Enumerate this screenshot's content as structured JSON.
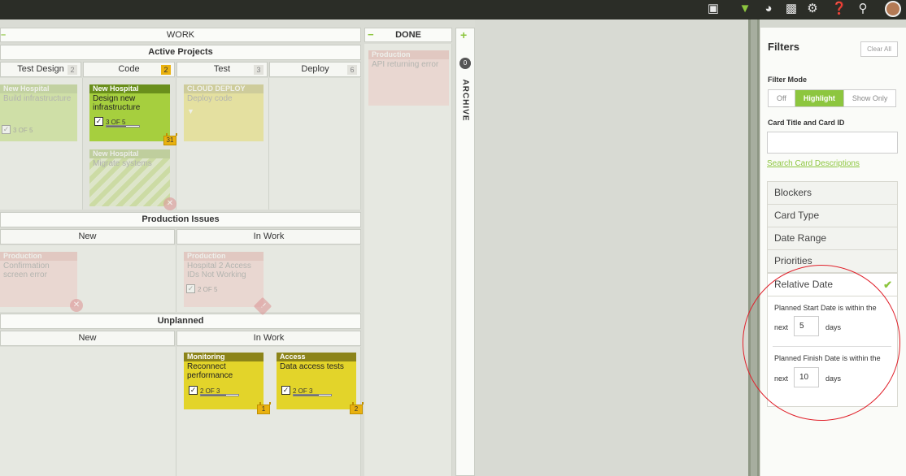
{
  "topbar": {
    "icons": [
      "new-card-icon",
      "filter-icon",
      "timer-icon",
      "analytics-icon",
      "gear-icon",
      "help-icon",
      "search-icon"
    ],
    "accent": "#8dc63f"
  },
  "board": {
    "work_header": "WORK",
    "done_header": "DONE",
    "archive_label": "ARCHIVE",
    "archive_count": "0",
    "lanes": {
      "active": {
        "title": "Active Projects",
        "columns": [
          {
            "label": "Test Design",
            "count": "2"
          },
          {
            "label": "Code",
            "count": "2"
          },
          {
            "label": "Test",
            "count": "3"
          },
          {
            "label": "Deploy",
            "count": "6"
          }
        ]
      },
      "production": {
        "title": "Production Issues",
        "columns": [
          {
            "label": "New"
          },
          {
            "label": "In Work"
          }
        ]
      },
      "unplanned": {
        "title": "Unplanned",
        "columns": [
          {
            "label": "New"
          },
          {
            "label": "In Work"
          }
        ]
      }
    },
    "cards": {
      "td1": {
        "title": "New Hospital",
        "body": "Build infrastructure",
        "progress": "3 OF 5"
      },
      "code1": {
        "title": "New Hospital",
        "body": "Design new infrastructure",
        "progress": "3 OF 5",
        "badge": "31"
      },
      "code2": {
        "title": "New Hospital",
        "body": "Migrate systems"
      },
      "test1": {
        "title": "CLOUD DEPLOY",
        "body": "Deploy code"
      },
      "done1": {
        "title": "Production",
        "body": "API returning error"
      },
      "pi_new1": {
        "title": "Production",
        "body": "Confirmation screen error"
      },
      "pi_work1": {
        "title": "Production",
        "body": "Hospital 2 Access IDs Not Working",
        "progress": "2 OF 5"
      },
      "up1": {
        "title": "Monitoring",
        "body": "Reconnect performance",
        "progress": "2 OF 3",
        "badge": "1"
      },
      "up2": {
        "title": "Access",
        "body": "Data access tests",
        "progress": "2 OF 3",
        "badge": "2"
      }
    }
  },
  "filters": {
    "title": "Filters",
    "clear_all": "Clear All",
    "filter_mode_label": "Filter Mode",
    "modes": [
      "Off",
      "Highlight",
      "Show Only"
    ],
    "active_mode": "Highlight",
    "card_title_label": "Card Title and Card ID",
    "card_title_value": "",
    "search_desc_link": "Search Card Descriptions",
    "sections": [
      "Blockers",
      "Card Type",
      "Date Range",
      "Priorities",
      "Relative Date"
    ],
    "relative_date": {
      "start_label": "Planned Start Date is within the",
      "start_next": "next",
      "start_value": "5",
      "start_unit": "days",
      "finish_label": "Planned Finish Date is within the",
      "finish_next": "next",
      "finish_value": "10",
      "finish_unit": "days"
    }
  },
  "colors": {
    "green_card": "#a6cf3e",
    "yellow_card": "#e3d42a",
    "pink_card": "#efb9b5",
    "annotation_circle": "#e0202a"
  }
}
